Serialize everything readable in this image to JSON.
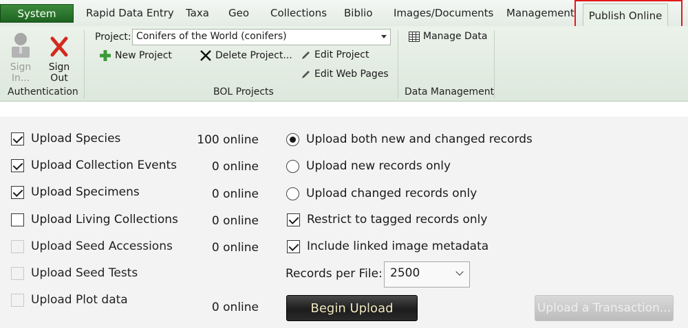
{
  "tabs": {
    "system": "System",
    "rapid_data_entry": "Rapid Data Entry",
    "taxa": "Taxa",
    "geo": "Geo",
    "collections": "Collections",
    "biblio": "Biblio",
    "images_documents": "Images/Documents",
    "management": "Management",
    "publish_online": "Publish Online"
  },
  "ribbon": {
    "authentication": {
      "sign_in_line1": "Sign",
      "sign_in_line2": "In...",
      "sign_out_line1": "Sign",
      "sign_out_line2": "Out",
      "group_label": "Authentication"
    },
    "bol_projects": {
      "project_label": "Project:",
      "project_value": "Conifers of the World (conifers)",
      "new_project": "New Project",
      "delete_project": "Delete Project...",
      "edit_project": "Edit Project",
      "edit_web_pages": "Edit Web Pages",
      "group_label": "BOL Projects"
    },
    "data_management": {
      "manage_data": "Manage Data",
      "group_label": "Data Management"
    }
  },
  "uploads": [
    {
      "label": "Upload Species",
      "checked": true,
      "enabled": true,
      "count": "100 online"
    },
    {
      "label": "Upload Collection Events",
      "checked": true,
      "enabled": true,
      "count": "0 online"
    },
    {
      "label": "Upload Specimens",
      "checked": true,
      "enabled": true,
      "count": "0 online"
    },
    {
      "label": "Upload Living Collections",
      "checked": false,
      "enabled": true,
      "count": "0 online"
    },
    {
      "label": "Upload Seed Accessions",
      "checked": false,
      "enabled": false,
      "count": "0 online"
    },
    {
      "label": "Upload Seed Tests",
      "checked": false,
      "enabled": false,
      "count": ""
    },
    {
      "label": "Upload Plot data",
      "checked": false,
      "enabled": false,
      "count": "0 online"
    }
  ],
  "options": {
    "radio_both": "Upload both new and changed records",
    "radio_new": "Upload new records only",
    "radio_changed": "Upload changed records only",
    "selected_radio": "both",
    "restrict_tagged": "Restrict to tagged records only",
    "restrict_tagged_checked": true,
    "include_images": "Include linked image metadata",
    "include_images_checked": true,
    "records_per_file_label": "Records per File:",
    "records_per_file_value": "2500"
  },
  "actions": {
    "begin_upload": "Begin Upload",
    "upload_transaction": "Upload a Transaction..."
  },
  "colors": {
    "system_button": "#2e7a30",
    "highlight": "#e01818",
    "ribbon": "#e4ede3"
  }
}
